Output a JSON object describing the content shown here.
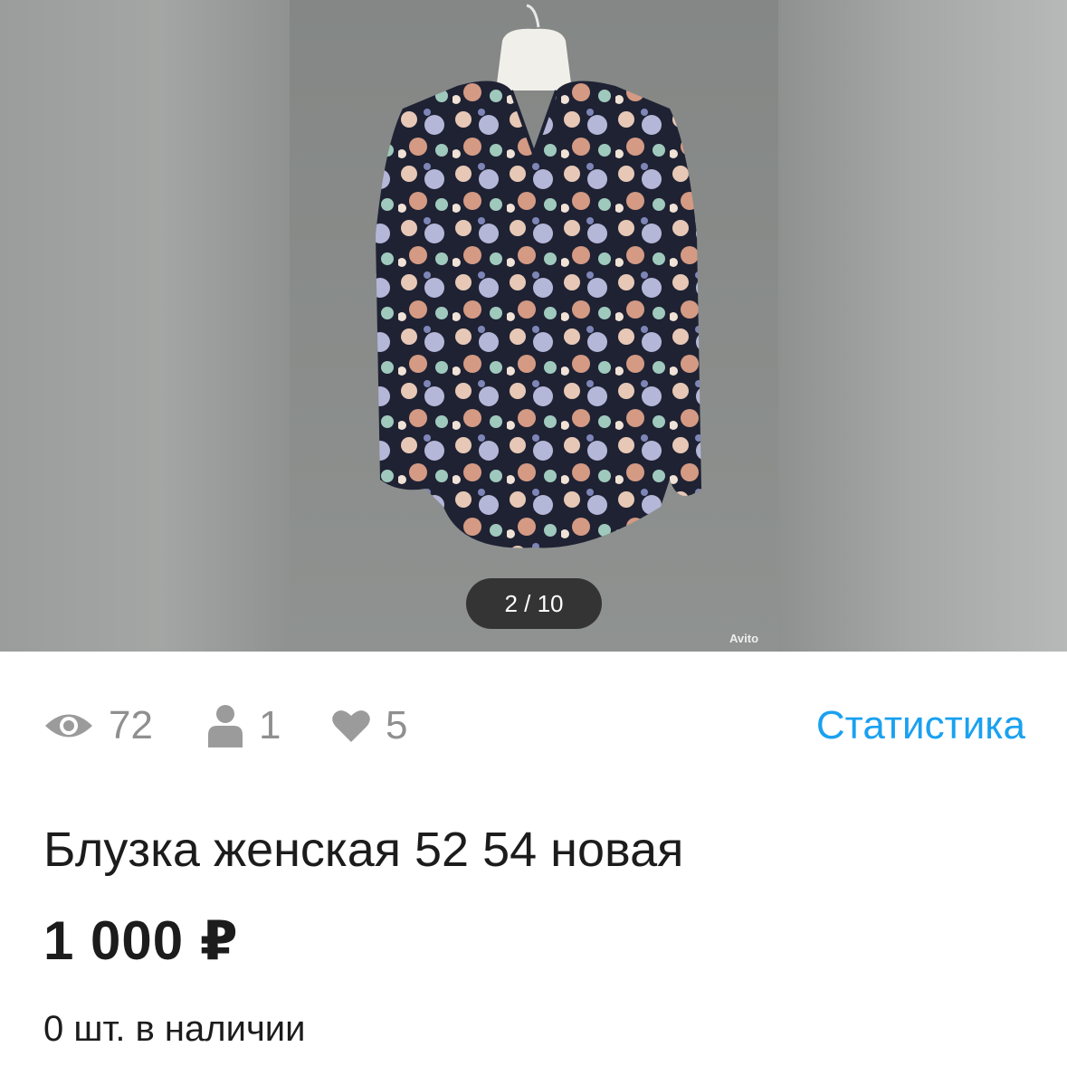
{
  "gallery": {
    "counter": "2 / 10",
    "watermark": "Avito"
  },
  "stats": {
    "views": "72",
    "contacts": "1",
    "favorites": "5",
    "link_label": "Статистика"
  },
  "listing": {
    "title": "Блузка женская 52 54 новая",
    "price": "1 000 ₽",
    "stock": "0 шт. в наличии"
  },
  "colors": {
    "accent": "#1aa1f0",
    "muted": "#8f8f8f",
    "text": "#1c1c1c"
  }
}
